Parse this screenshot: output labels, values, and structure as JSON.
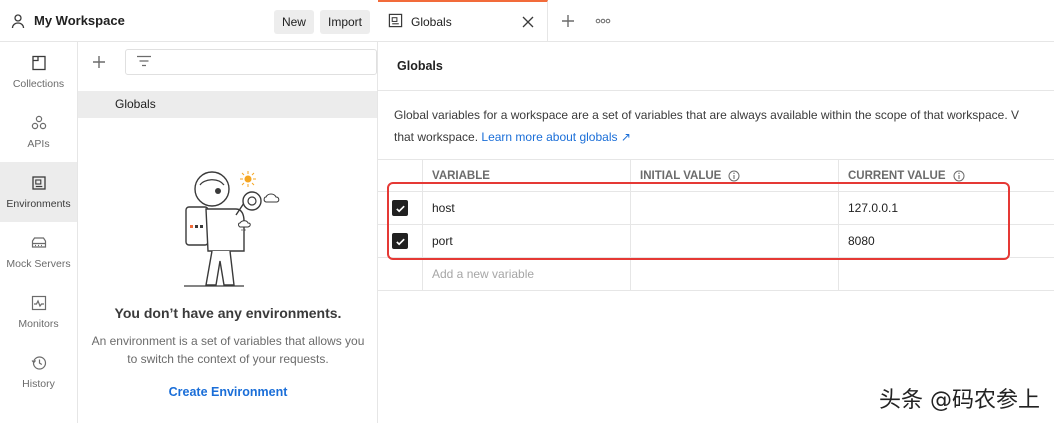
{
  "workspace": {
    "title": "My Workspace",
    "new_label": "New",
    "import_label": "Import"
  },
  "rail": {
    "items": [
      {
        "label": "Collections",
        "icon": "collections-icon"
      },
      {
        "label": "APIs",
        "icon": "apis-icon"
      },
      {
        "label": "Environments",
        "icon": "environments-icon",
        "active": true
      },
      {
        "label": "Mock Servers",
        "icon": "mock-servers-icon"
      },
      {
        "label": "Monitors",
        "icon": "monitors-icon"
      },
      {
        "label": "History",
        "icon": "history-icon"
      }
    ]
  },
  "panel": {
    "globals_label": "Globals",
    "empty_title": "You don’t have any environments.",
    "empty_description": "An environment is a set of variables that allows you to switch the context of your requests.",
    "create_label": "Create Environment"
  },
  "tabs": {
    "active_label": "Globals"
  },
  "content": {
    "title": "Globals",
    "description_line1": "Global variables for a workspace are a set of variables that are always available within the scope of that workspace. V",
    "description_line2": "that workspace.",
    "learn_more": "Learn more about globals ↗"
  },
  "table": {
    "headers": [
      "VARIABLE",
      "INITIAL VALUE",
      "CURRENT VALUE"
    ],
    "rows": [
      {
        "variable": "host",
        "initial": "",
        "current": "127.0.0.1",
        "checked": true
      },
      {
        "variable": "port",
        "initial": "",
        "current": "8080",
        "checked": true
      }
    ],
    "add_placeholder": "Add a new variable"
  },
  "watermark": "头条 @码农参上",
  "colors": {
    "accent_tab": "#f26b3a",
    "link": "#1a6ed8",
    "highlight": "#e53935"
  }
}
